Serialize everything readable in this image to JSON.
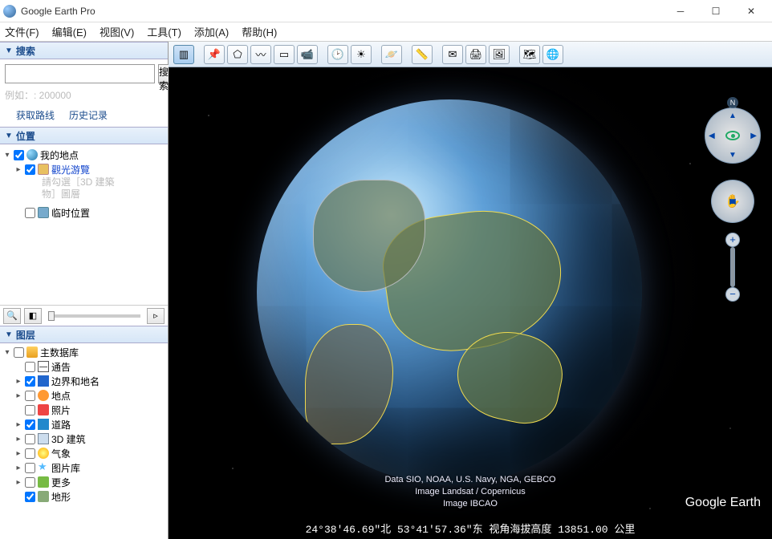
{
  "window": {
    "title": "Google Earth Pro"
  },
  "menu": {
    "file": "文件(F)",
    "edit": "编辑(E)",
    "view": "视图(V)",
    "tools": "工具(T)",
    "add": "添加(A)",
    "help": "帮助(H)"
  },
  "search": {
    "header": "搜索",
    "placeholder": "",
    "button": "搜索",
    "hint": "例如：: 200000",
    "directions": "获取路线",
    "history": "历史记录"
  },
  "places": {
    "header": "位置",
    "my_places": "我的地点",
    "sightseeing": "觀光游覽",
    "hint_line1": "請勾選［3D 建築",
    "hint_line2": "物］圖層",
    "temp": "临时位置"
  },
  "layers": {
    "header": "图层",
    "db": "主数据库",
    "items": [
      {
        "label": "通告",
        "icon": "mail",
        "checked": false,
        "exp": ""
      },
      {
        "label": "边界和地名",
        "icon": "flag",
        "checked": true,
        "exp": "▸"
      },
      {
        "label": "地点",
        "icon": "dot",
        "checked": false,
        "exp": "▸"
      },
      {
        "label": "照片",
        "icon": "photo",
        "checked": false,
        "exp": ""
      },
      {
        "label": "道路",
        "icon": "road",
        "checked": true,
        "exp": "▸"
      },
      {
        "label": "3D 建筑",
        "icon": "3d",
        "checked": false,
        "exp": "▸"
      },
      {
        "label": "气象",
        "icon": "weather",
        "checked": false,
        "exp": "▸"
      },
      {
        "label": "图片库",
        "icon": "star",
        "checked": false,
        "exp": "▸"
      },
      {
        "label": "更多",
        "icon": "more",
        "checked": false,
        "exp": "▸"
      },
      {
        "label": "地形",
        "icon": "terr",
        "checked": true,
        "exp": ""
      }
    ]
  },
  "attribution": {
    "line1": "Data SIO, NOAA, U.S. Navy, NGA, GEBCO",
    "line2": "Image Landsat / Copernicus",
    "line3": "Image IBCAO"
  },
  "logo": "Google Earth",
  "status": "24°38'46.69\"北  53°41'57.36\"东 视角海拔高度 13851.00 公里",
  "compass_n": "N"
}
